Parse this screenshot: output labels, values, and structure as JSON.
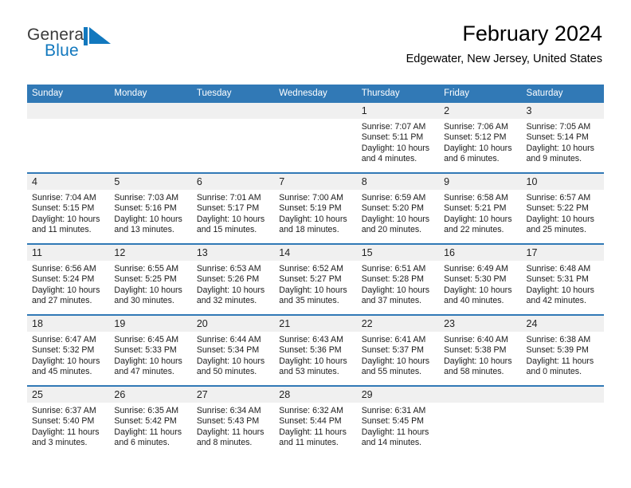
{
  "brand": {
    "name_part1": "General",
    "name_part2": "Blue",
    "logo_icon": "blue-triangle-mark",
    "color_primary": "#1278be",
    "color_header": "#3179b6"
  },
  "header": {
    "title": "February 2024",
    "subtitle": "Edgewater, New Jersey, United States"
  },
  "weekdays": [
    "Sunday",
    "Monday",
    "Tuesday",
    "Wednesday",
    "Thursday",
    "Friday",
    "Saturday"
  ],
  "weeks": [
    [
      {
        "day": "",
        "lines": []
      },
      {
        "day": "",
        "lines": []
      },
      {
        "day": "",
        "lines": []
      },
      {
        "day": "",
        "lines": []
      },
      {
        "day": "1",
        "lines": [
          "Sunrise: 7:07 AM",
          "Sunset: 5:11 PM",
          "Daylight: 10 hours",
          "and 4 minutes."
        ]
      },
      {
        "day": "2",
        "lines": [
          "Sunrise: 7:06 AM",
          "Sunset: 5:12 PM",
          "Daylight: 10 hours",
          "and 6 minutes."
        ]
      },
      {
        "day": "3",
        "lines": [
          "Sunrise: 7:05 AM",
          "Sunset: 5:14 PM",
          "Daylight: 10 hours",
          "and 9 minutes."
        ]
      }
    ],
    [
      {
        "day": "4",
        "lines": [
          "Sunrise: 7:04 AM",
          "Sunset: 5:15 PM",
          "Daylight: 10 hours",
          "and 11 minutes."
        ]
      },
      {
        "day": "5",
        "lines": [
          "Sunrise: 7:03 AM",
          "Sunset: 5:16 PM",
          "Daylight: 10 hours",
          "and 13 minutes."
        ]
      },
      {
        "day": "6",
        "lines": [
          "Sunrise: 7:01 AM",
          "Sunset: 5:17 PM",
          "Daylight: 10 hours",
          "and 15 minutes."
        ]
      },
      {
        "day": "7",
        "lines": [
          "Sunrise: 7:00 AM",
          "Sunset: 5:19 PM",
          "Daylight: 10 hours",
          "and 18 minutes."
        ]
      },
      {
        "day": "8",
        "lines": [
          "Sunrise: 6:59 AM",
          "Sunset: 5:20 PM",
          "Daylight: 10 hours",
          "and 20 minutes."
        ]
      },
      {
        "day": "9",
        "lines": [
          "Sunrise: 6:58 AM",
          "Sunset: 5:21 PM",
          "Daylight: 10 hours",
          "and 22 minutes."
        ]
      },
      {
        "day": "10",
        "lines": [
          "Sunrise: 6:57 AM",
          "Sunset: 5:22 PM",
          "Daylight: 10 hours",
          "and 25 minutes."
        ]
      }
    ],
    [
      {
        "day": "11",
        "lines": [
          "Sunrise: 6:56 AM",
          "Sunset: 5:24 PM",
          "Daylight: 10 hours",
          "and 27 minutes."
        ]
      },
      {
        "day": "12",
        "lines": [
          "Sunrise: 6:55 AM",
          "Sunset: 5:25 PM",
          "Daylight: 10 hours",
          "and 30 minutes."
        ]
      },
      {
        "day": "13",
        "lines": [
          "Sunrise: 6:53 AM",
          "Sunset: 5:26 PM",
          "Daylight: 10 hours",
          "and 32 minutes."
        ]
      },
      {
        "day": "14",
        "lines": [
          "Sunrise: 6:52 AM",
          "Sunset: 5:27 PM",
          "Daylight: 10 hours",
          "and 35 minutes."
        ]
      },
      {
        "day": "15",
        "lines": [
          "Sunrise: 6:51 AM",
          "Sunset: 5:28 PM",
          "Daylight: 10 hours",
          "and 37 minutes."
        ]
      },
      {
        "day": "16",
        "lines": [
          "Sunrise: 6:49 AM",
          "Sunset: 5:30 PM",
          "Daylight: 10 hours",
          "and 40 minutes."
        ]
      },
      {
        "day": "17",
        "lines": [
          "Sunrise: 6:48 AM",
          "Sunset: 5:31 PM",
          "Daylight: 10 hours",
          "and 42 minutes."
        ]
      }
    ],
    [
      {
        "day": "18",
        "lines": [
          "Sunrise: 6:47 AM",
          "Sunset: 5:32 PM",
          "Daylight: 10 hours",
          "and 45 minutes."
        ]
      },
      {
        "day": "19",
        "lines": [
          "Sunrise: 6:45 AM",
          "Sunset: 5:33 PM",
          "Daylight: 10 hours",
          "and 47 minutes."
        ]
      },
      {
        "day": "20",
        "lines": [
          "Sunrise: 6:44 AM",
          "Sunset: 5:34 PM",
          "Daylight: 10 hours",
          "and 50 minutes."
        ]
      },
      {
        "day": "21",
        "lines": [
          "Sunrise: 6:43 AM",
          "Sunset: 5:36 PM",
          "Daylight: 10 hours",
          "and 53 minutes."
        ]
      },
      {
        "day": "22",
        "lines": [
          "Sunrise: 6:41 AM",
          "Sunset: 5:37 PM",
          "Daylight: 10 hours",
          "and 55 minutes."
        ]
      },
      {
        "day": "23",
        "lines": [
          "Sunrise: 6:40 AM",
          "Sunset: 5:38 PM",
          "Daylight: 10 hours",
          "and 58 minutes."
        ]
      },
      {
        "day": "24",
        "lines": [
          "Sunrise: 6:38 AM",
          "Sunset: 5:39 PM",
          "Daylight: 11 hours",
          "and 0 minutes."
        ]
      }
    ],
    [
      {
        "day": "25",
        "lines": [
          "Sunrise: 6:37 AM",
          "Sunset: 5:40 PM",
          "Daylight: 11 hours",
          "and 3 minutes."
        ]
      },
      {
        "day": "26",
        "lines": [
          "Sunrise: 6:35 AM",
          "Sunset: 5:42 PM",
          "Daylight: 11 hours",
          "and 6 minutes."
        ]
      },
      {
        "day": "27",
        "lines": [
          "Sunrise: 6:34 AM",
          "Sunset: 5:43 PM",
          "Daylight: 11 hours",
          "and 8 minutes."
        ]
      },
      {
        "day": "28",
        "lines": [
          "Sunrise: 6:32 AM",
          "Sunset: 5:44 PM",
          "Daylight: 11 hours",
          "and 11 minutes."
        ]
      },
      {
        "day": "29",
        "lines": [
          "Sunrise: 6:31 AM",
          "Sunset: 5:45 PM",
          "Daylight: 11 hours",
          "and 14 minutes."
        ]
      },
      {
        "day": "",
        "lines": []
      },
      {
        "day": "",
        "lines": []
      }
    ]
  ]
}
